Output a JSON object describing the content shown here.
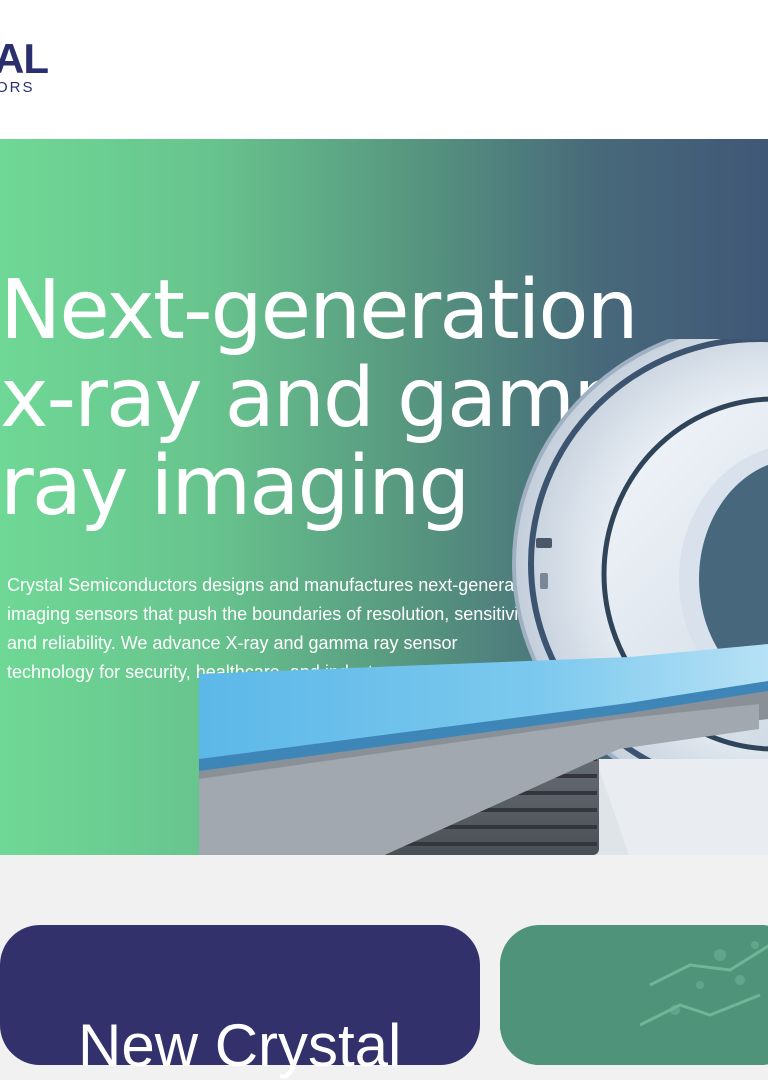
{
  "brand": {
    "logo_main": "AL",
    "logo_sub": "ORS"
  },
  "hero": {
    "title_lines": [
      "Next-generation",
      "x-ray and gamma",
      "ray imaging"
    ],
    "description": "Crystal Semiconductors designs and manufactures next-generation imaging sensors that push the boundaries of resolution, sensitivity and reliability. We advance X-ray and gamma ray sensor technology for security, healthcare, and industry."
  },
  "cards": {
    "left_title": "New Crystal"
  },
  "colors": {
    "brand_navy": "#2b2f6e",
    "gradient_start": "#6fd896",
    "gradient_end": "#405777",
    "card_navy": "#33316b",
    "card_green": "#4f947a"
  }
}
